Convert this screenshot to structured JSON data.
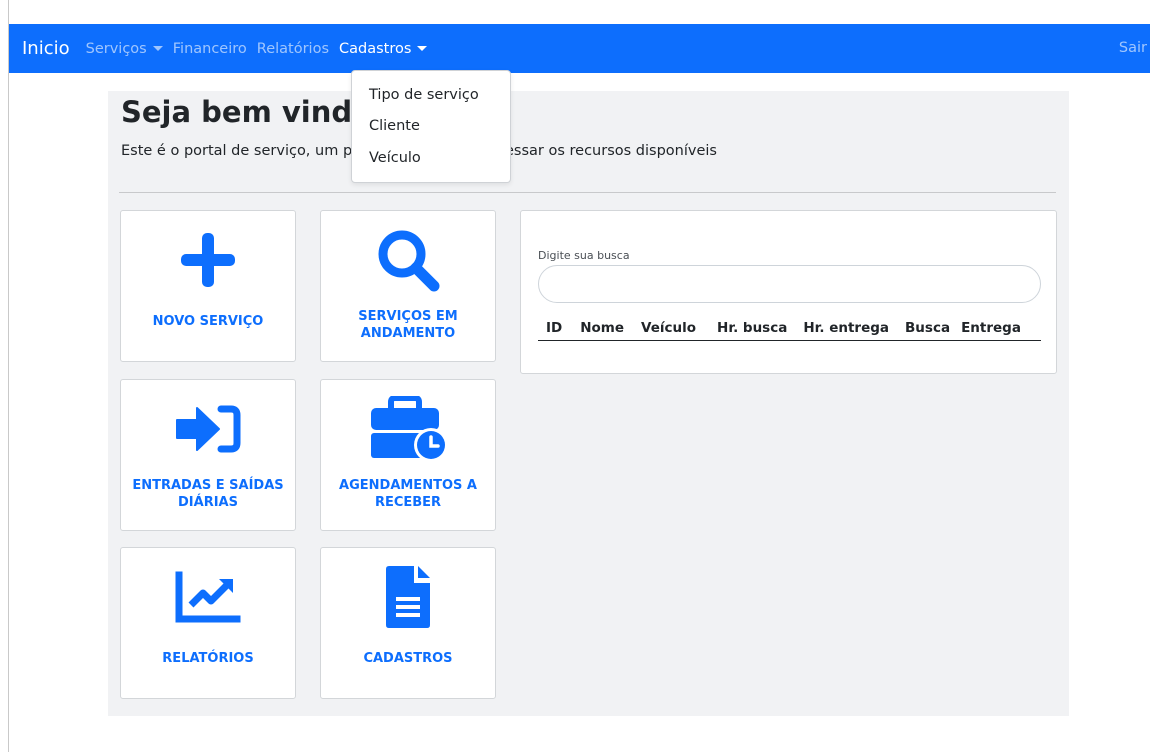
{
  "colors": {
    "primary": "#0d6efd",
    "jumbotron": "#f1f2f4",
    "text": "#212529"
  },
  "navbar": {
    "brand": "Inicio",
    "items": [
      {
        "label": "Serviços",
        "dropdown": true
      },
      {
        "label": "Financeiro",
        "dropdown": false
      },
      {
        "label": "Relatórios",
        "dropdown": false
      },
      {
        "label": "Cadastros",
        "dropdown": true,
        "active": true
      }
    ],
    "logout": "Sair"
  },
  "dropdown": {
    "items": [
      "Tipo de serviço",
      "Cliente",
      "Veículo"
    ]
  },
  "jumbotron": {
    "title": "Seja bem vindo",
    "subtitle_start": "Este é o portal de serviço, um po",
    "subtitle_end": "cessar os recursos disponíveis"
  },
  "cards": [
    {
      "label": "NOVO SERVIÇO",
      "icon": "plus-icon"
    },
    {
      "label": "SERVIÇOS EM ANDAMENTO",
      "icon": "search-icon"
    },
    {
      "label": "ENTRADAS E SAÍDAS DIÁRIAS",
      "icon": "sign-in-icon"
    },
    {
      "label": "AGENDAMENTOS A RECEBER",
      "icon": "briefcase-clock-icon"
    },
    {
      "label": "RELATÓRIOS",
      "icon": "chart-line-icon"
    },
    {
      "label": "CADASTROS",
      "icon": "file-icon"
    }
  ],
  "search": {
    "label": "Digite sua busca",
    "value": "",
    "columns": [
      "ID",
      "Nome",
      "Veículo",
      "Hr. busca",
      "Hr. entrega",
      "Busca",
      "Entrega"
    ]
  }
}
